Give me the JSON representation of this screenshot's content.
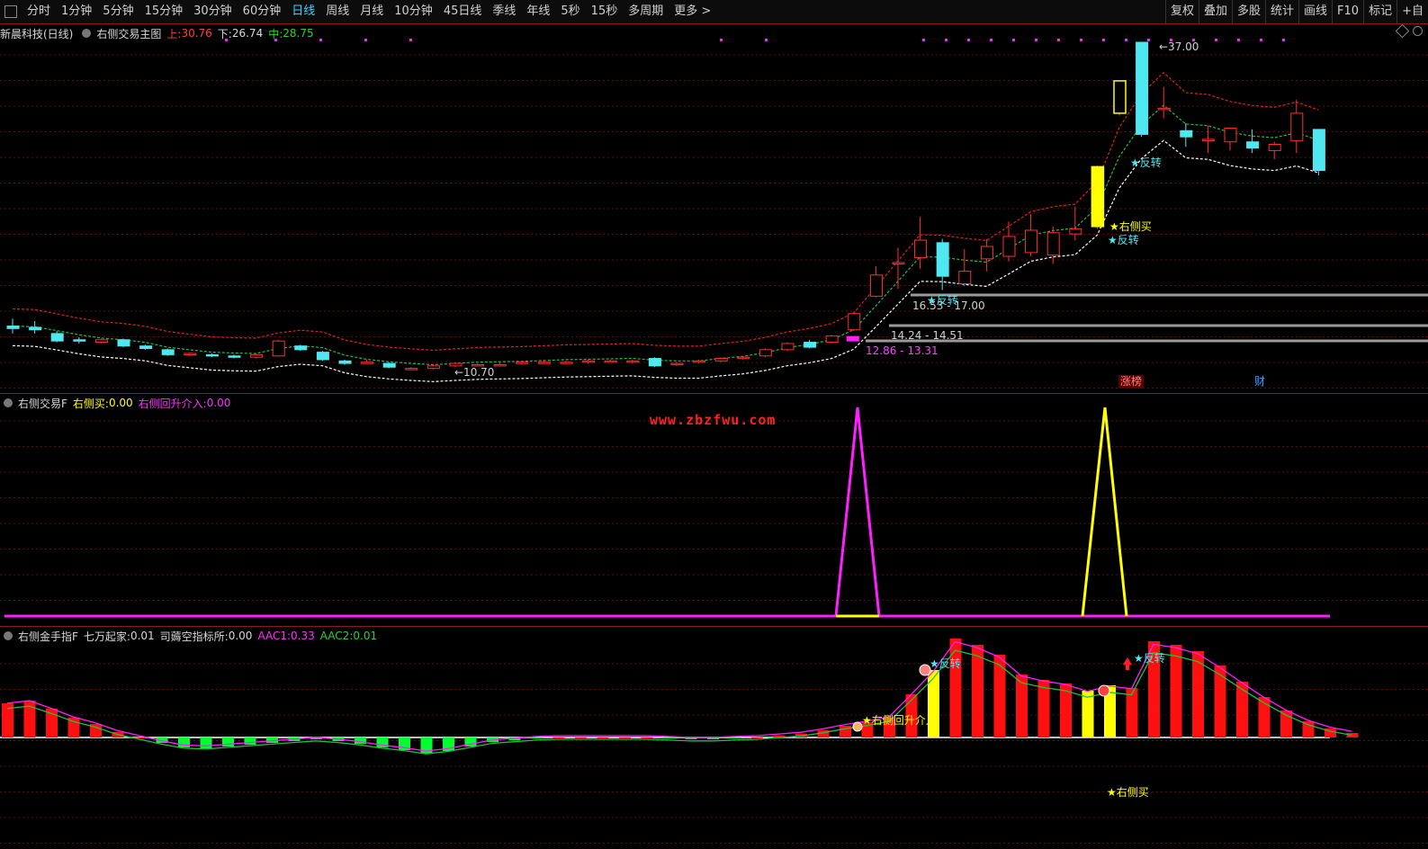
{
  "toolbar": {
    "periods": [
      "分时",
      "1分钟",
      "5分钟",
      "15分钟",
      "30分钟",
      "60分钟",
      "日线",
      "周线",
      "月线",
      "10分钟",
      "45日线",
      "季线",
      "年线",
      "5秒",
      "15秒",
      "多周期",
      "更多 >"
    ],
    "active_period": "日线",
    "right_buttons": [
      "复权",
      "叠加",
      "多股",
      "统计",
      "画线",
      "F10",
      "标记",
      "+自"
    ]
  },
  "main": {
    "stock": "新晨科技(日线)",
    "indicator": "右侧交易主图",
    "upper_label": "上:",
    "upper_value": "30.76",
    "lower_label": "下:",
    "lower_value": "26.74",
    "mid_label": "中:",
    "mid_value": "28.75",
    "price_labels": {
      "high": "37.00",
      "low": "10.70",
      "range1": "16.53 - 17.00",
      "range2": "14.24 - 14.51",
      "range3": "12.86 - 13.31"
    },
    "signals": {
      "reversal": "★反转",
      "right_buy": "★右侧买"
    },
    "events": {
      "limit_up": "涨榜",
      "finance": "财"
    }
  },
  "ind1": {
    "name": "右侧交易F",
    "k1": "右侧买:",
    "v1": "0.00",
    "k2": "右侧回升介入:",
    "v2": "0.00",
    "watermark": "www.zbzfwu.com"
  },
  "ind2": {
    "name": "右侧金手指F",
    "k1": "七万起家:",
    "v1": "0.01",
    "k2": "司薅空指标所:",
    "v2": "0.00",
    "k3": "AAC1:",
    "v3": "0.33",
    "k4": "AAC2:",
    "v4": "0.01",
    "signals": {
      "reversal": "★反转",
      "right_pullback": "★右侧回升介入",
      "right_buy": "★右侧买"
    }
  },
  "colors": {
    "up": "#ff3030",
    "down": "#50e8f0",
    "upper_band": "#e02020",
    "mid_band": "#20c040",
    "lower_band": "#ffffff",
    "magenta": "#ff20ff",
    "yellow": "#ffff00",
    "green_bar": "#00ff30",
    "red_bar": "#ff1010"
  },
  "chart_data": {
    "type": "candlestick",
    "price_range": [
      10.7,
      37.0
    ],
    "candles": [
      {
        "o": 14.2,
        "c": 14.0,
        "h": 14.8,
        "l": 13.6
      },
      {
        "o": 14.1,
        "c": 13.9,
        "h": 14.6,
        "l": 13.6
      },
      {
        "o": 13.6,
        "c": 13.0,
        "h": 13.8,
        "l": 12.9
      },
      {
        "o": 13.1,
        "c": 13.0,
        "h": 13.3,
        "l": 12.8
      },
      {
        "o": 12.9,
        "c": 13.1,
        "h": 13.2,
        "l": 12.8
      },
      {
        "o": 13.1,
        "c": 12.6,
        "h": 13.2,
        "l": 12.5
      },
      {
        "o": 12.6,
        "c": 12.4,
        "h": 12.7,
        "l": 12.3
      },
      {
        "o": 12.3,
        "c": 11.9,
        "h": 12.4,
        "l": 11.8
      },
      {
        "o": 11.9,
        "c": 12.0,
        "h": 12.1,
        "l": 11.8
      },
      {
        "o": 11.9,
        "c": 11.8,
        "h": 12.0,
        "l": 11.7
      },
      {
        "o": 11.8,
        "c": 11.7,
        "h": 11.9,
        "l": 11.6
      },
      {
        "o": 11.7,
        "c": 11.9,
        "h": 12.0,
        "l": 11.6
      },
      {
        "o": 11.8,
        "c": 13.0,
        "h": 13.1,
        "l": 11.8
      },
      {
        "o": 12.6,
        "c": 12.3,
        "h": 12.7,
        "l": 12.2
      },
      {
        "o": 12.1,
        "c": 11.5,
        "h": 12.2,
        "l": 11.4
      },
      {
        "o": 11.4,
        "c": 11.2,
        "h": 11.5,
        "l": 11.1
      },
      {
        "o": 11.3,
        "c": 11.3,
        "h": 11.5,
        "l": 11.2
      },
      {
        "o": 11.2,
        "c": 10.9,
        "h": 11.3,
        "l": 10.8
      },
      {
        "o": 10.8,
        "c": 10.8,
        "h": 10.9,
        "l": 10.7
      },
      {
        "o": 10.8,
        "c": 11.0,
        "h": 11.1,
        "l": 10.7
      },
      {
        "o": 11.0,
        "c": 11.2,
        "h": 11.3,
        "l": 10.9
      },
      {
        "o": 11.1,
        "c": 11.1,
        "h": 11.2,
        "l": 11.0
      },
      {
        "o": 11.1,
        "c": 11.1,
        "h": 11.3,
        "l": 11.0
      },
      {
        "o": 11.2,
        "c": 11.3,
        "h": 11.4,
        "l": 11.1
      },
      {
        "o": 11.3,
        "c": 11.3,
        "h": 11.5,
        "l": 11.2
      },
      {
        "o": 11.3,
        "c": 11.3,
        "h": 11.4,
        "l": 11.2
      },
      {
        "o": 11.3,
        "c": 11.4,
        "h": 11.5,
        "l": 11.2
      },
      {
        "o": 11.4,
        "c": 11.4,
        "h": 11.5,
        "l": 11.3
      },
      {
        "o": 11.3,
        "c": 11.4,
        "h": 11.5,
        "l": 11.2
      },
      {
        "o": 11.6,
        "c": 11.0,
        "h": 11.7,
        "l": 10.9
      },
      {
        "o": 11.1,
        "c": 11.2,
        "h": 11.3,
        "l": 11.0
      },
      {
        "o": 11.3,
        "c": 11.4,
        "h": 11.5,
        "l": 11.2
      },
      {
        "o": 11.4,
        "c": 11.6,
        "h": 11.7,
        "l": 11.3
      },
      {
        "o": 11.6,
        "c": 11.7,
        "h": 11.8,
        "l": 11.5
      },
      {
        "o": 11.8,
        "c": 12.3,
        "h": 12.4,
        "l": 11.7
      },
      {
        "o": 12.3,
        "c": 12.8,
        "h": 12.9,
        "l": 12.2
      },
      {
        "o": 12.9,
        "c": 12.5,
        "h": 13.1,
        "l": 12.4
      },
      {
        "o": 12.9,
        "c": 13.4,
        "h": 13.5,
        "l": 12.8
      },
      {
        "o": 13.9,
        "c": 15.2,
        "h": 15.3,
        "l": 13.8
      },
      {
        "o": 16.6,
        "c": 18.3,
        "h": 19.0,
        "l": 16.5
      },
      {
        "o": 19.2,
        "c": 19.3,
        "h": 20.5,
        "l": 17.2
      },
      {
        "o": 19.7,
        "c": 21.1,
        "h": 23.0,
        "l": 18.8
      },
      {
        "o": 20.9,
        "c": 18.2,
        "h": 21.2,
        "l": 17.1
      },
      {
        "o": 17.6,
        "c": 18.6,
        "h": 20.4,
        "l": 17.4
      },
      {
        "o": 19.6,
        "c": 20.6,
        "h": 21.2,
        "l": 18.6
      },
      {
        "o": 19.8,
        "c": 21.4,
        "h": 22.6,
        "l": 19.4
      },
      {
        "o": 20.1,
        "c": 21.9,
        "h": 23.2,
        "l": 19.8
      },
      {
        "o": 19.9,
        "c": 21.7,
        "h": 22.2,
        "l": 19.2
      },
      {
        "o": 21.6,
        "c": 22.0,
        "h": 23.8,
        "l": 21.1
      },
      {
        "o": 22.2,
        "c": 27.0,
        "h": 27.1,
        "l": 22.0
      },
      {
        "o": 31.3,
        "c": 33.9,
        "h": 33.9,
        "l": 31.1
      },
      {
        "o": 37.0,
        "c": 29.6,
        "h": 37.0,
        "l": 29.4
      },
      {
        "o": 31.7,
        "c": 31.7,
        "h": 33.4,
        "l": 30.9
      },
      {
        "o": 29.9,
        "c": 29.4,
        "h": 30.5,
        "l": 28.6
      },
      {
        "o": 29.1,
        "c": 29.2,
        "h": 30.3,
        "l": 28.1
      },
      {
        "o": 29.0,
        "c": 30.1,
        "h": 30.1,
        "l": 28.3
      },
      {
        "o": 29.0,
        "c": 28.5,
        "h": 30.0,
        "l": 28.1
      },
      {
        "o": 28.3,
        "c": 28.8,
        "h": 29.0,
        "l": 27.6
      },
      {
        "o": 29.1,
        "c": 31.3,
        "h": 32.4,
        "l": 28.1
      },
      {
        "o": 30.0,
        "c": 26.7,
        "h": 30.0,
        "l": 26.3
      }
    ]
  }
}
